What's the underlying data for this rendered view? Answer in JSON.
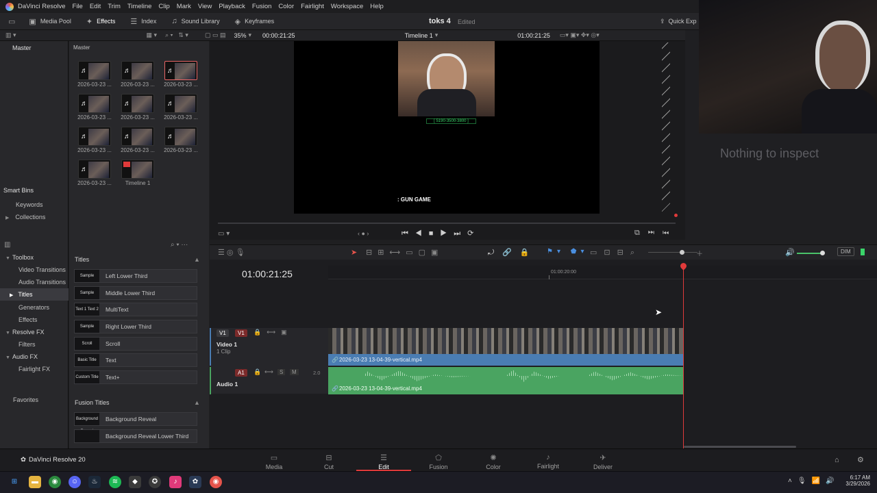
{
  "app": {
    "name": "DaVinci Resolve",
    "menu": [
      "File",
      "Edit",
      "Trim",
      "Timeline",
      "Clip",
      "Mark",
      "View",
      "Playback",
      "Fusion",
      "Color",
      "Fairlight",
      "Workspace",
      "Help"
    ]
  },
  "toolbar": {
    "media_pool": "Media Pool",
    "effects": "Effects",
    "index": "Index",
    "sound_library": "Sound Library",
    "keyframes": "Keyframes",
    "project_title": "toks 4",
    "project_status": "Edited",
    "quick_export": "Quick Exp"
  },
  "subbar": {
    "zoom": "35%",
    "timecode_left": "00:00:21:25",
    "timeline_name": "Timeline 1",
    "timecode_right": "01:00:21:25"
  },
  "left_panel": {
    "master_label": "Master",
    "smart_bins": "Smart Bins",
    "keywords": "Keywords",
    "collections": "Collections"
  },
  "media_pool": {
    "header": "Master",
    "clips": [
      {
        "label": "2026-03-23 ...",
        "selected": false
      },
      {
        "label": "2026-03-23 ...",
        "selected": false
      },
      {
        "label": "2026-03-23 ...",
        "selected": true
      },
      {
        "label": "2026-03-23 ...",
        "selected": false
      },
      {
        "label": "2026-03-23 ...",
        "selected": false
      },
      {
        "label": "2026-03-23 ...",
        "selected": false
      },
      {
        "label": "2026-03-23 ...",
        "selected": false
      },
      {
        "label": "2026-03-23 ...",
        "selected": false
      },
      {
        "label": "2026-03-23 ...",
        "selected": false
      },
      {
        "label": "2026-03-23 ...",
        "selected": false
      },
      {
        "label": "Timeline 1",
        "selected": false
      }
    ]
  },
  "viewer": {
    "overlay_text": "GUN GAME",
    "overlay_small": "[ 5190-3500-3800 ]"
  },
  "inspector": {
    "empty_message": "Nothing to inspect"
  },
  "effects_panel": {
    "toolbox": "Toolbox",
    "video_transitions": "Video Transitions",
    "audio_transitions": "Audio Transitions",
    "titles": "Titles",
    "generators": "Generators",
    "effects": "Effects",
    "resolve_fx": "Resolve FX",
    "filters": "Filters",
    "audio_fx": "Audio FX",
    "fairlight_fx": "Fairlight FX",
    "favorites": "Favorites"
  },
  "titles_list": {
    "header": "Titles",
    "items": [
      {
        "thumb": "Sample",
        "name": "Left Lower Third"
      },
      {
        "thumb": "Sample",
        "name": "Middle Lower Third"
      },
      {
        "thumb": "Text 1 Text 2",
        "name": "MultiText"
      },
      {
        "thumb": "Sample",
        "name": "Right Lower Third"
      },
      {
        "thumb": "Scroll",
        "name": "Scroll"
      },
      {
        "thumb": "Basic Title",
        "name": "Text"
      },
      {
        "thumb": "Custom Title",
        "name": "Text+"
      }
    ],
    "fusion_header": "Fusion Titles",
    "fusion_items": [
      {
        "thumb": "Background Reveal",
        "name": "Background Reveal"
      },
      {
        "thumb": "",
        "name": "Background Reveal Lower Third"
      }
    ]
  },
  "timeline": {
    "timecode": "01:00:21:25",
    "ruler_mark": "01:00:20:00",
    "dim_label": "DIM",
    "video_track": {
      "tag": "V1",
      "dest": "V1",
      "name": "Video 1",
      "clips": "1 Clip",
      "clip_name": "2026-03-23 13-04-39-vertical.mp4"
    },
    "audio_track": {
      "tag": "A1",
      "name": "Audio 1",
      "level": "2.0",
      "solo": "S",
      "mute": "M",
      "clip_name": "2026-03-23 13-04-39-vertical.mp4"
    }
  },
  "pages": {
    "app_label": "DaVinci Resolve 20",
    "items": [
      "Media",
      "Cut",
      "Edit",
      "Fusion",
      "Color",
      "Fairlight",
      "Deliver"
    ],
    "active": "Edit"
  },
  "taskbar": {
    "time": "6:17 AM",
    "date": "3/29/2026"
  }
}
